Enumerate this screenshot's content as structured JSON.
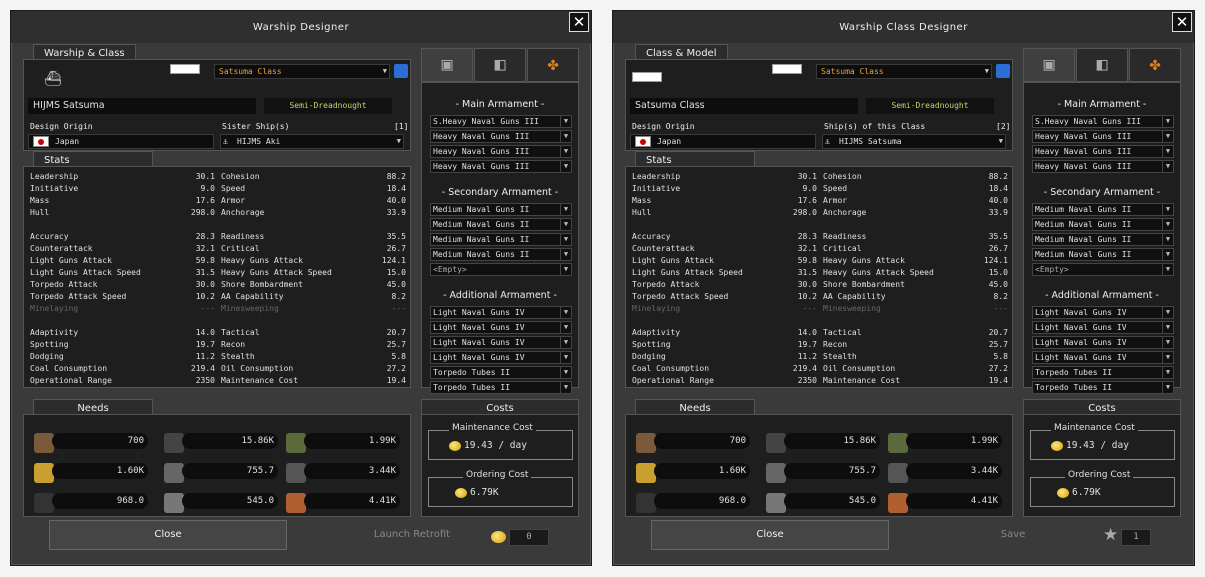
{
  "left": {
    "title": "Warship Designer",
    "close_glyph": "✕",
    "tag": "Warship & Class",
    "ship_name": "HIJMS Satsuma",
    "class_select": "Satsuma Class",
    "type_label": "Semi-Dreadnought",
    "origin_label": "Design Origin",
    "origin_value": "Japan",
    "sister_label": "Sister Ship(s)",
    "sister_count": "[1]",
    "sister_value": "HIJMS Aki",
    "bottom_left_btn": "Close",
    "bottom_right_btn": "Launch Retrofit",
    "bottom_value": "0"
  },
  "right": {
    "title": "Warship Class Designer",
    "close_glyph": "✕",
    "tag": "Class & Model",
    "ship_name": "Satsuma Class",
    "class_select": "Satsuma Class",
    "type_label": "Semi-Dreadnought",
    "origin_label": "Design Origin",
    "origin_value": "Japan",
    "sister_label": "Ship(s) of this Class",
    "sister_count": "[2]",
    "sister_value": "HIJMS Satsuma",
    "bottom_left_btn": "Close",
    "bottom_right_btn": "Save",
    "bottom_value": "1"
  },
  "stats_title": "Stats",
  "stats_col1": [
    [
      "Leadership",
      "30.1"
    ],
    [
      "Initiative",
      "9.0"
    ],
    [
      "Mass",
      "17.6"
    ],
    [
      "Hull",
      "298.0"
    ],
    null,
    [
      "Accuracy",
      "28.3"
    ],
    [
      "Counterattack",
      "32.1"
    ],
    [
      "Light Guns Attack",
      "59.8"
    ],
    [
      "Light Guns Attack Speed",
      "31.5"
    ],
    [
      "Torpedo Attack",
      "30.0"
    ],
    [
      "Torpedo Attack Speed",
      "10.2"
    ],
    [
      "Minelaying",
      "---"
    ],
    null,
    [
      "Adaptivity",
      "14.0"
    ],
    [
      "Spotting",
      "19.7"
    ],
    [
      "Dodging",
      "11.2"
    ],
    [
      "Coal Consumption",
      "219.4"
    ],
    [
      "Operational Range",
      "2350"
    ]
  ],
  "stats_col2": [
    [
      "Cohesion",
      "88.2"
    ],
    [
      "Speed",
      "18.4"
    ],
    [
      "Armor",
      "40.0"
    ],
    [
      "Anchorage",
      "33.9"
    ],
    null,
    [
      "Readiness",
      "35.5"
    ],
    [
      "Critical",
      "26.7"
    ],
    [
      "Heavy Guns Attack",
      "124.1"
    ],
    [
      "Heavy Guns Attack Speed",
      "15.0"
    ],
    [
      "Shore Bombardment",
      "45.0"
    ],
    [
      "AA Capability",
      "8.2"
    ],
    [
      "Minesweeping",
      "---"
    ],
    null,
    [
      "Tactical",
      "20.7"
    ],
    [
      "Recon",
      "25.7"
    ],
    [
      "Stealth",
      "5.8"
    ],
    [
      "Oil Consumption",
      "27.2"
    ],
    [
      "Maintenance Cost",
      "19.4"
    ]
  ],
  "main_armament_title": "- Main Armament -",
  "main_armament_left": [
    "S.Heavy Naval Guns III",
    "Heavy Naval Guns III",
    "Heavy Naval Guns III",
    "Heavy Naval Guns III"
  ],
  "main_armament_right": [
    "S.Heavy Naval Guns III",
    "Heavy Naval Guns III",
    "Heavy Naval Guns III",
    "Heavy Naval Guns III"
  ],
  "secondary_title": "- Secondary Armament -",
  "secondary": [
    "Medium Naval Guns II",
    "Medium Naval Guns II",
    "Medium Naval Guns II",
    "Medium Naval Guns II",
    "<Empty>"
  ],
  "additional_title": "- Additional Armament -",
  "additional": [
    "Light Naval Guns IV",
    "Light Naval Guns IV",
    "Light Naval Guns IV",
    "Light Naval Guns IV",
    "Torpedo Tubes II",
    "Torpedo Tubes II"
  ],
  "needs_title": "Needs",
  "needs": [
    [
      "700",
      "15.86K",
      "1.99K"
    ],
    [
      "1.60K",
      "755.7",
      "3.44K"
    ],
    [
      "968.0",
      "545.0",
      "4.41K"
    ]
  ],
  "costs_title": "Costs",
  "maint_label": "Maintenance Cost",
  "maint_value": "19.43 / day",
  "order_label": "Ordering Cost",
  "order_value": "6.79K"
}
